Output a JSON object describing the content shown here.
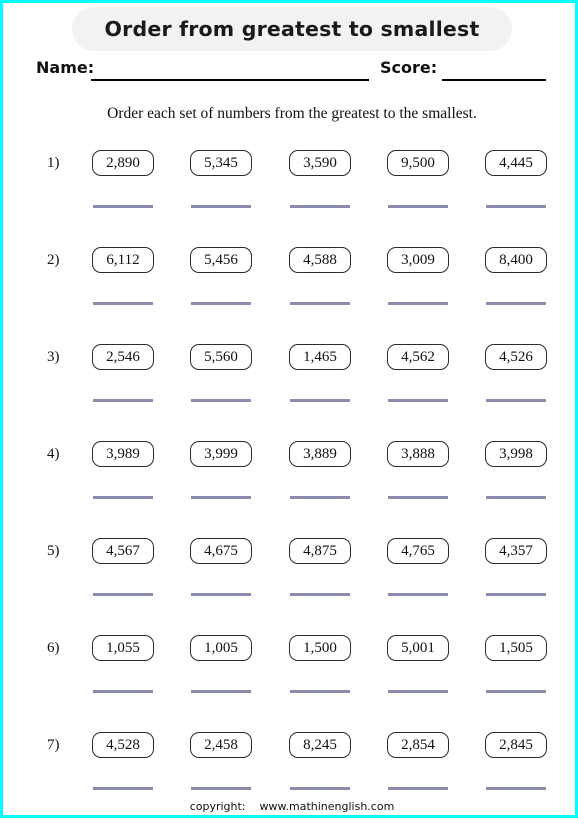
{
  "page": {
    "border_color": "#00ffff",
    "background": "#ffffff"
  },
  "header": {
    "title": "Order from greatest to smallest",
    "banner_color": "#f2f2f2",
    "name_label": "Name:",
    "name_value": "",
    "score_label": "Score:",
    "score_value": ""
  },
  "instruction": "Order each set of numbers from the greatest to the smallest.",
  "worksheet": {
    "answer_line_color": "#8b8bae",
    "box_border_color": "#2b2b2b",
    "rows": [
      {
        "number": "1)",
        "numbers": [
          "2,890",
          "5,345",
          "3,590",
          "9,500",
          "4,445"
        ],
        "answers": [
          "",
          "",
          "",
          "",
          ""
        ]
      },
      {
        "number": "2)",
        "numbers": [
          "6,112",
          "5,456",
          "4,588",
          "3,009",
          "8,400"
        ],
        "answers": [
          "",
          "",
          "",
          "",
          ""
        ]
      },
      {
        "number": "3)",
        "numbers": [
          "2,546",
          "5,560",
          "1,465",
          "4,562",
          "4,526"
        ],
        "answers": [
          "",
          "",
          "",
          "",
          ""
        ]
      },
      {
        "number": "4)",
        "numbers": [
          "3,989",
          "3,999",
          "3,889",
          "3,888",
          "3,998"
        ],
        "answers": [
          "",
          "",
          "",
          "",
          ""
        ]
      },
      {
        "number": "5)",
        "numbers": [
          "4,567",
          "4,675",
          "4,875",
          "4,765",
          "4,357"
        ],
        "answers": [
          "",
          "",
          "",
          "",
          ""
        ]
      },
      {
        "number": "6)",
        "numbers": [
          "1,055",
          "1,005",
          "1,500",
          "5,001",
          "1,505"
        ],
        "answers": [
          "",
          "",
          "",
          "",
          ""
        ]
      },
      {
        "number": "7)",
        "numbers": [
          "4,528",
          "2,458",
          "8,245",
          "2,854",
          "2,845"
        ],
        "answers": [
          "",
          "",
          "",
          "",
          ""
        ]
      }
    ]
  },
  "footer": {
    "copyright_label": "copyright:",
    "site": "www.mathinenglish.com"
  },
  "layout": {
    "row_tops": [
      142,
      239,
      336,
      433,
      530,
      627,
      724
    ],
    "column_lefts": [
      89,
      187,
      286,
      384,
      482
    ]
  }
}
